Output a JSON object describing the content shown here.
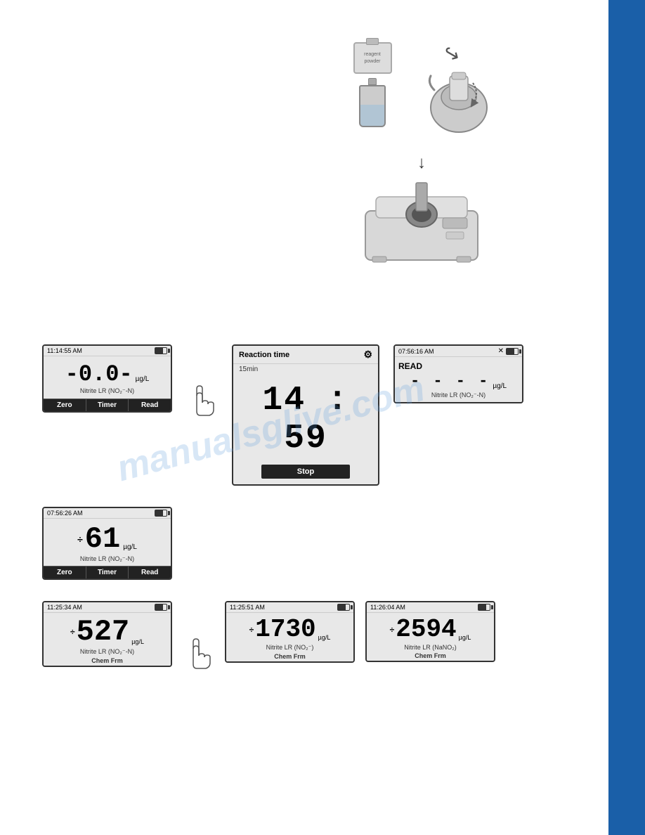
{
  "page": {
    "background": "#ffffff",
    "watermark": "manualsglive.com"
  },
  "sidebar": {
    "color": "#1a5fa8"
  },
  "illustrations": {
    "packet_label": "reagent\npowder",
    "arrow_down": "↓",
    "step1_alt": "Add reagent to bottle",
    "step2_alt": "Mix on vortex mixer",
    "step3_alt": "Insert cuvette into spectrophotometer"
  },
  "screens": {
    "row1": [
      {
        "id": "screen-zero",
        "time": "11:14:55 AM",
        "value": "-0.0-",
        "unit": "µg/L",
        "label": "Nitrite LR (NO₂⁻-N)",
        "footer": [
          "Zero",
          "Timer",
          "Read"
        ],
        "type": "zero"
      },
      {
        "id": "screen-timer",
        "title": "Reaction time",
        "subtitle": "15min",
        "timer_display": "14 : 59",
        "stop_label": "Stop",
        "type": "timer"
      },
      {
        "id": "screen-read",
        "time": "07:56:16 AM",
        "header_label": "READ",
        "value": "- - - -",
        "unit": "µg/L",
        "label": "Nitrite LR (NO₂⁻-N)",
        "type": "read"
      }
    ],
    "row2": [
      {
        "id": "screen-result",
        "time": "07:56:26 AM",
        "value": "61",
        "unit": "µg/L",
        "label": "Nitrite LR (NO₂⁻-N)",
        "footer": [
          "Zero",
          "Timer",
          "Read"
        ],
        "type": "result"
      }
    ],
    "row3": [
      {
        "id": "screen-527",
        "time": "11:25:34 AM",
        "value": "527",
        "unit": "µg/L",
        "label": "Nitrite LR (NO₂⁻-N)",
        "sublabel": "Chem Frm",
        "type": "chem"
      },
      {
        "id": "screen-1730",
        "time": "11:25:51 AM",
        "value": "1730",
        "unit": "µg/L",
        "label": "Nitrite LR (NO₂⁻)",
        "sublabel": "Chem Frm",
        "type": "chem"
      },
      {
        "id": "screen-2594",
        "time": "11:26:04 AM",
        "value": "2594",
        "unit": "µg/L",
        "label": "Nitrite LR (NaNO₂)",
        "sublabel": "Chem Frm",
        "type": "chem"
      }
    ]
  }
}
